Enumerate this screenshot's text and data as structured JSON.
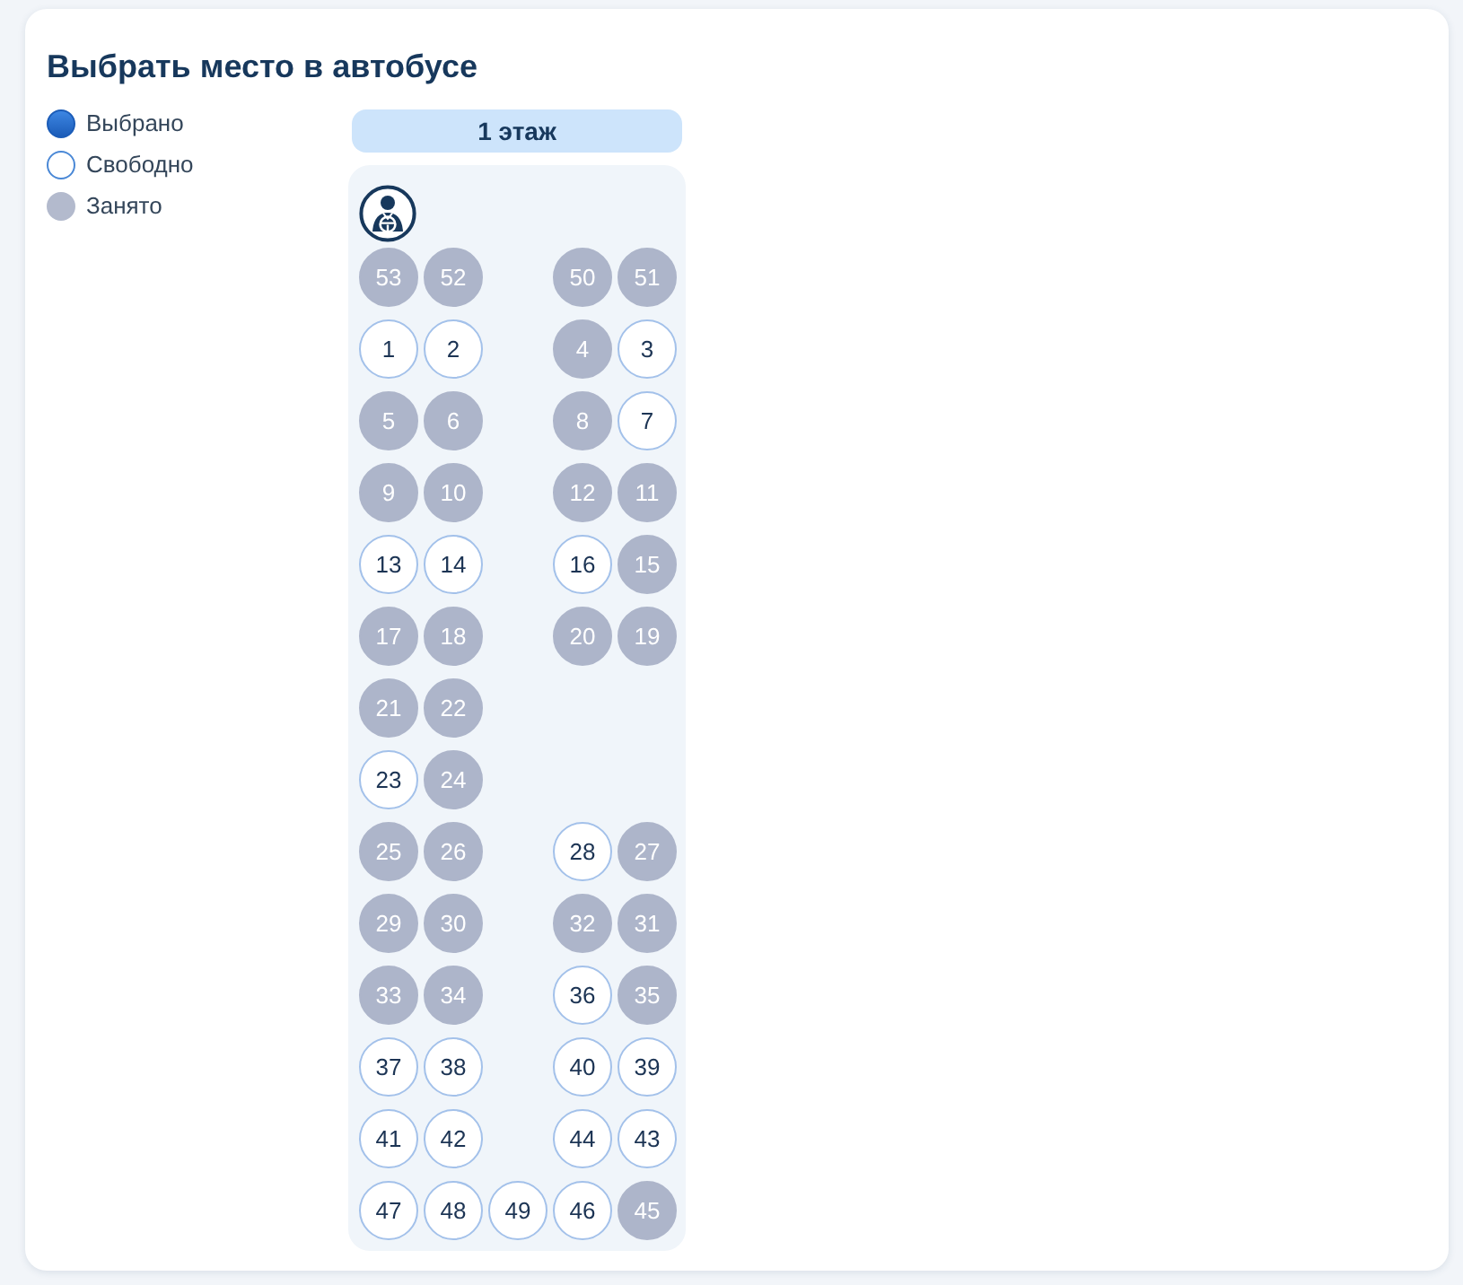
{
  "title": "Выбрать место в автобусе",
  "legend": [
    {
      "label": "Выбрано",
      "kind": "selected"
    },
    {
      "label": "Свободно",
      "kind": "free"
    },
    {
      "label": "Занято",
      "kind": "occupied"
    }
  ],
  "floor": {
    "label": "1 этаж"
  },
  "rows": [
    {
      "left": [
        {
          "number": "53",
          "selected": false,
          "occupied": true
        },
        {
          "number": "52",
          "selected": false,
          "occupied": true
        }
      ],
      "right": [
        {
          "number": "50",
          "selected": false,
          "occupied": true
        },
        {
          "number": "51",
          "selected": false,
          "occupied": true
        }
      ]
    },
    {
      "left": [
        {
          "number": "1",
          "selected": false,
          "occupied": false
        },
        {
          "number": "2",
          "selected": false,
          "occupied": false
        }
      ],
      "right": [
        {
          "number": "4",
          "selected": false,
          "occupied": true
        },
        {
          "number": "3",
          "selected": false,
          "occupied": false
        }
      ]
    },
    {
      "left": [
        {
          "number": "5",
          "selected": false,
          "occupied": true
        },
        {
          "number": "6",
          "selected": false,
          "occupied": true
        }
      ],
      "right": [
        {
          "number": "8",
          "selected": false,
          "occupied": true
        },
        {
          "number": "7",
          "selected": false,
          "occupied": false
        }
      ]
    },
    {
      "left": [
        {
          "number": "9",
          "selected": false,
          "occupied": true
        },
        {
          "number": "10",
          "selected": false,
          "occupied": true
        }
      ],
      "right": [
        {
          "number": "12",
          "selected": false,
          "occupied": true
        },
        {
          "number": "11",
          "selected": false,
          "occupied": true
        }
      ]
    },
    {
      "left": [
        {
          "number": "13",
          "selected": false,
          "occupied": false
        },
        {
          "number": "14",
          "selected": false,
          "occupied": false
        }
      ],
      "right": [
        {
          "number": "16",
          "selected": false,
          "occupied": false
        },
        {
          "number": "15",
          "selected": false,
          "occupied": true
        }
      ]
    },
    {
      "left": [
        {
          "number": "17",
          "selected": false,
          "occupied": true
        },
        {
          "number": "18",
          "selected": false,
          "occupied": true
        }
      ],
      "right": [
        {
          "number": "20",
          "selected": false,
          "occupied": true
        },
        {
          "number": "19",
          "selected": false,
          "occupied": true
        }
      ]
    },
    {
      "left": [
        {
          "number": "21",
          "selected": false,
          "occupied": true
        },
        {
          "number": "22",
          "selected": false,
          "occupied": true
        }
      ]
    },
    {
      "left": [
        {
          "number": "23",
          "selected": false,
          "occupied": false
        },
        {
          "number": "24",
          "selected": false,
          "occupied": true
        }
      ]
    },
    {
      "left": [
        {
          "number": "25",
          "selected": false,
          "occupied": true
        },
        {
          "number": "26",
          "selected": false,
          "occupied": true
        }
      ],
      "right": [
        {
          "number": "28",
          "selected": false,
          "occupied": false
        },
        {
          "number": "27",
          "selected": false,
          "occupied": true
        }
      ]
    },
    {
      "left": [
        {
          "number": "29",
          "selected": false,
          "occupied": true
        },
        {
          "number": "30",
          "selected": false,
          "occupied": true
        }
      ],
      "right": [
        {
          "number": "32",
          "selected": false,
          "occupied": true
        },
        {
          "number": "31",
          "selected": false,
          "occupied": true
        }
      ]
    },
    {
      "left": [
        {
          "number": "33",
          "selected": false,
          "occupied": true
        },
        {
          "number": "34",
          "selected": false,
          "occupied": true
        }
      ],
      "right": [
        {
          "number": "36",
          "selected": false,
          "occupied": false
        },
        {
          "number": "35",
          "selected": false,
          "occupied": true
        }
      ]
    },
    {
      "left": [
        {
          "number": "37",
          "selected": false,
          "occupied": false
        },
        {
          "number": "38",
          "selected": false,
          "occupied": false
        }
      ],
      "right": [
        {
          "number": "40",
          "selected": false,
          "occupied": false
        },
        {
          "number": "39",
          "selected": false,
          "occupied": false
        }
      ]
    },
    {
      "left": [
        {
          "number": "41",
          "selected": false,
          "occupied": false
        },
        {
          "number": "42",
          "selected": false,
          "occupied": false
        }
      ],
      "right": [
        {
          "number": "44",
          "selected": false,
          "occupied": false
        },
        {
          "number": "43",
          "selected": false,
          "occupied": false
        }
      ]
    },
    {
      "left": [
        {
          "number": "47",
          "selected": false,
          "occupied": false
        },
        {
          "number": "48",
          "selected": false,
          "occupied": false
        }
      ],
      "middle": [
        {
          "number": "49",
          "selected": false,
          "occupied": false
        }
      ],
      "right": [
        {
          "number": "46",
          "selected": false,
          "occupied": false
        },
        {
          "number": "45",
          "selected": false,
          "occupied": true
        }
      ]
    }
  ]
}
